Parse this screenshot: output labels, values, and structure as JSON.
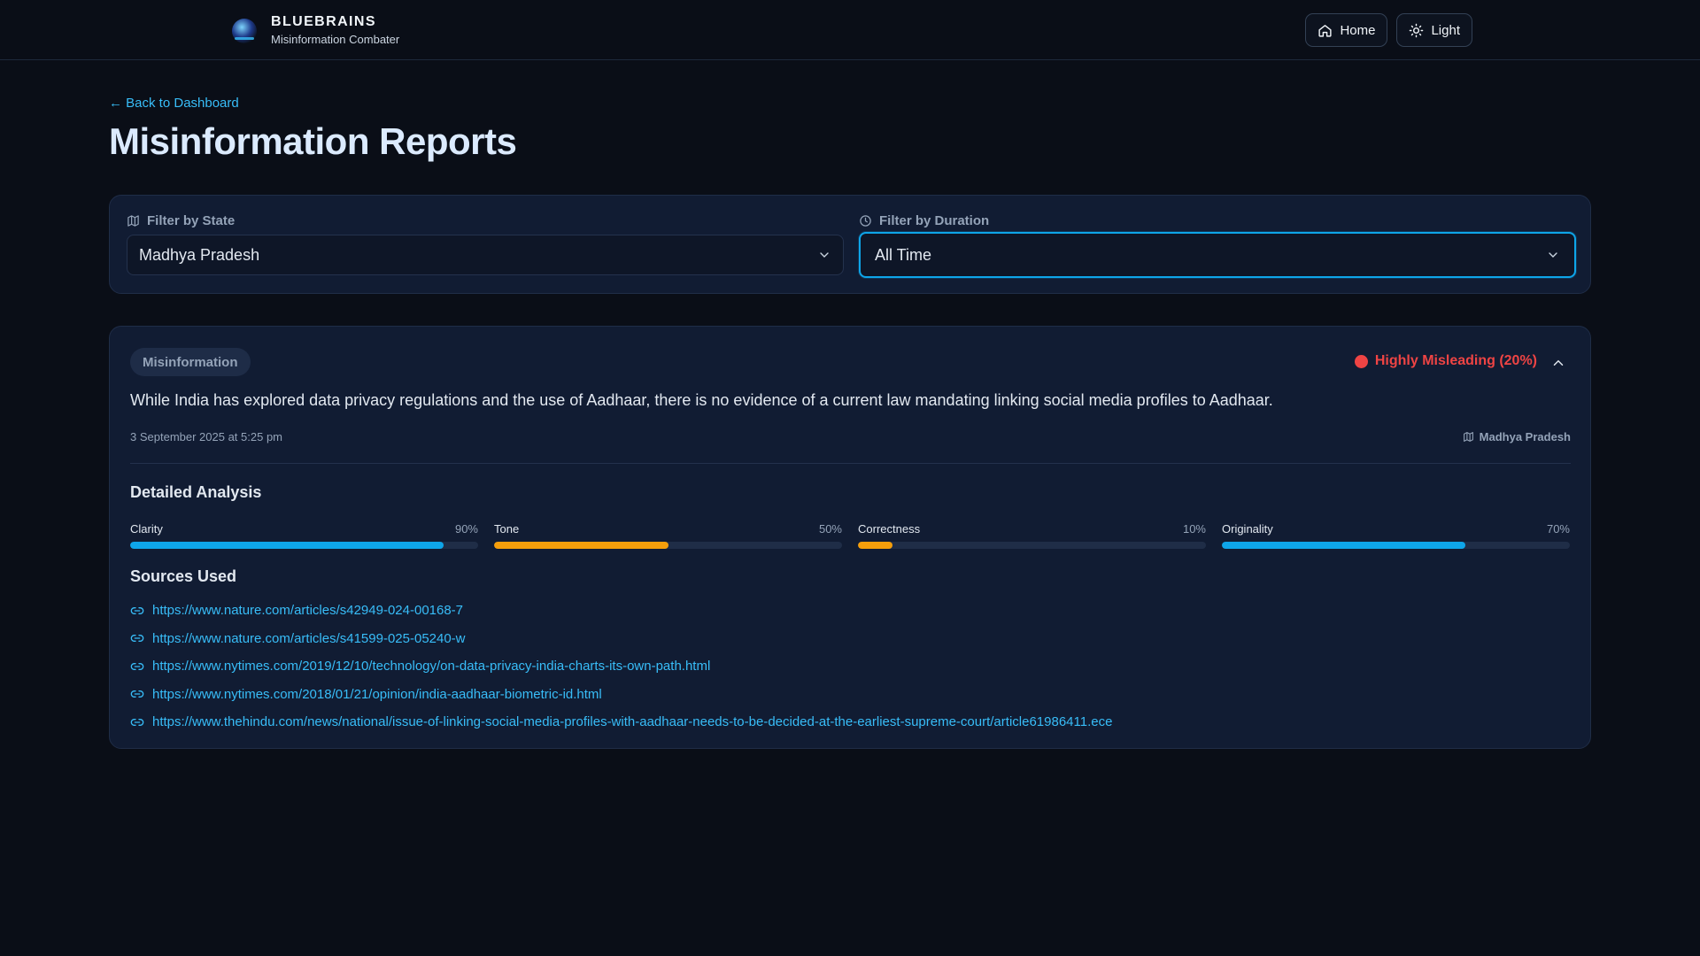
{
  "header": {
    "brand_title": "BLUEBRAINS",
    "brand_subtitle": "Misinformation Combater",
    "nav": [
      {
        "label": "Home",
        "icon": "home-icon"
      },
      {
        "label": "Light",
        "icon": "sun-icon"
      }
    ]
  },
  "main": {
    "back_link": "← Back to Dashboard",
    "title": "Misinformation Reports"
  },
  "filters": {
    "state": {
      "label": "Filter by State",
      "icon": "map-icon",
      "value": "Madhya Pradesh"
    },
    "duration": {
      "label": "Filter by Duration",
      "icon": "clock-icon",
      "value": "All Time"
    }
  },
  "report": {
    "tag": "Misinformation",
    "verdict": "Highly Misleading (20%)",
    "verdict_color": "#ef4444",
    "claim": "While India has explored data privacy regulations and the use of Aadhaar, there is no evidence of a current law mandating linking social media profiles to Aadhaar.",
    "date": "3 September 2025 at 5:25 pm",
    "location": "Madhya Pradesh",
    "analysis_title": "Detailed Analysis",
    "metrics": [
      {
        "name": "Clarity",
        "value_label": "90%",
        "value": 0.9,
        "color": "#0ea5e9"
      },
      {
        "name": "Tone",
        "value_label": "50%",
        "value": 0.5,
        "color": "#f59e0b"
      },
      {
        "name": "Correctness",
        "value_label": "10%",
        "value": 0.1,
        "color": "#f59e0b"
      },
      {
        "name": "Originality",
        "value_label": "70%",
        "value": 0.7,
        "color": "#0ea5e9"
      }
    ],
    "sources_title": "Sources Used",
    "sources": [
      "https://www.nature.com/articles/s42949-024-00168-7",
      "https://www.nature.com/articles/s41599-025-05240-w",
      "https://www.nytimes.com/2019/12/10/technology/on-data-privacy-india-charts-its-own-path.html",
      "https://www.nytimes.com/2018/01/21/opinion/india-aadhaar-biometric-id.html",
      "https://www.thehindu.com/news/national/issue-of-linking-social-media-profiles-with-aadhaar-needs-to-be-decided-at-the-earliest-supreme-court/article61986411.ece"
    ]
  },
  "colors": {
    "background": "#0a0e17",
    "card": "#111c33",
    "accent": "#38bdf8"
  }
}
